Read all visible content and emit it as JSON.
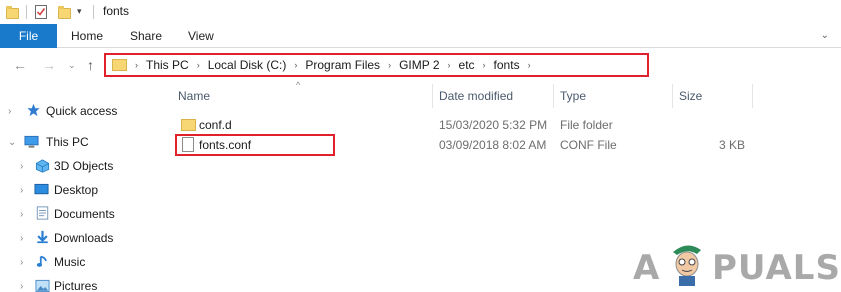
{
  "window": {
    "title": "fonts"
  },
  "ribbon": {
    "tabs": [
      {
        "label": "File",
        "active": true
      },
      {
        "label": "Home"
      },
      {
        "label": "Share"
      },
      {
        "label": "View"
      }
    ]
  },
  "address": {
    "crumbs": [
      "This PC",
      "Local Disk (C:)",
      "Program Files",
      "GIMP 2",
      "etc",
      "fonts"
    ]
  },
  "sidebar": {
    "items": [
      {
        "label": "Quick access",
        "icon": "star-icon"
      },
      {
        "label": "This PC",
        "icon": "computer-icon"
      },
      {
        "label": "3D Objects",
        "icon": "cube-icon"
      },
      {
        "label": "Desktop",
        "icon": "desktop-icon"
      },
      {
        "label": "Documents",
        "icon": "document-icon"
      },
      {
        "label": "Downloads",
        "icon": "download-icon"
      },
      {
        "label": "Music",
        "icon": "music-icon"
      },
      {
        "label": "Pictures",
        "icon": "pictures-icon"
      }
    ]
  },
  "columns": {
    "name": "Name",
    "date": "Date modified",
    "type": "Type",
    "size": "Size"
  },
  "files": [
    {
      "name": "conf.d",
      "date": "15/03/2020 5:32 PM",
      "type": "File folder",
      "size": "",
      "icon": "folder-icon"
    },
    {
      "name": "fonts.conf",
      "date": "03/09/2018 8:02 AM",
      "type": "CONF File",
      "size": "3 KB",
      "icon": "file-icon"
    }
  ],
  "watermark": {
    "text_left": "A",
    "text_right": "PUALS"
  },
  "colors": {
    "accent": "#1979ca",
    "highlight": "#e0202a",
    "folder": "#f7d774"
  }
}
